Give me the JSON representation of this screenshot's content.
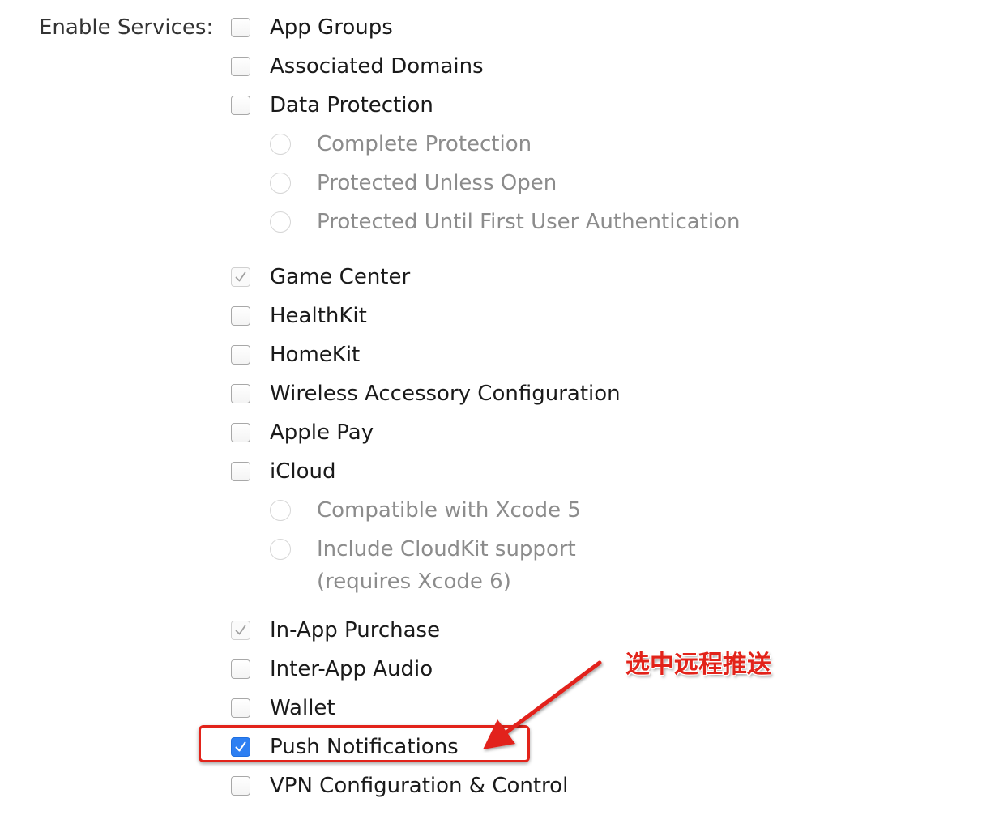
{
  "enable_services_label": "Enable Services:",
  "services": [
    {
      "label": "App Groups",
      "state": "unchecked"
    },
    {
      "label": "Associated Domains",
      "state": "unchecked"
    },
    {
      "label": "Data Protection",
      "state": "unchecked"
    },
    {
      "label": "Game Center",
      "state": "checked-disabled"
    },
    {
      "label": "HealthKit",
      "state": "unchecked"
    },
    {
      "label": "HomeKit",
      "state": "unchecked"
    },
    {
      "label": "Wireless Accessory Configuration",
      "state": "unchecked"
    },
    {
      "label": "Apple Pay",
      "state": "unchecked"
    },
    {
      "label": "iCloud",
      "state": "unchecked"
    },
    {
      "label": "In-App Purchase",
      "state": "checked-disabled"
    },
    {
      "label": "Inter-App Audio",
      "state": "unchecked"
    },
    {
      "label": "Wallet",
      "state": "unchecked"
    },
    {
      "label": "Push Notifications",
      "state": "checked"
    },
    {
      "label": "VPN Configuration & Control",
      "state": "unchecked"
    }
  ],
  "data_protection_options": [
    {
      "label": "Complete Protection",
      "selected": false
    },
    {
      "label": "Protected Unless Open",
      "selected": false
    },
    {
      "label": "Protected Until First User Authentication",
      "selected": false
    }
  ],
  "icloud_options": [
    {
      "label": "Compatible with Xcode 5",
      "selected": false
    },
    {
      "label": "Include CloudKit support",
      "selected": false
    }
  ],
  "icloud_option_note": "(requires Xcode 6)",
  "annotation": {
    "text": "选中远程推送",
    "color": "#e2231a"
  },
  "colors": {
    "checkbox_checked": "#2d7ff2",
    "highlight": "#e2231a"
  }
}
